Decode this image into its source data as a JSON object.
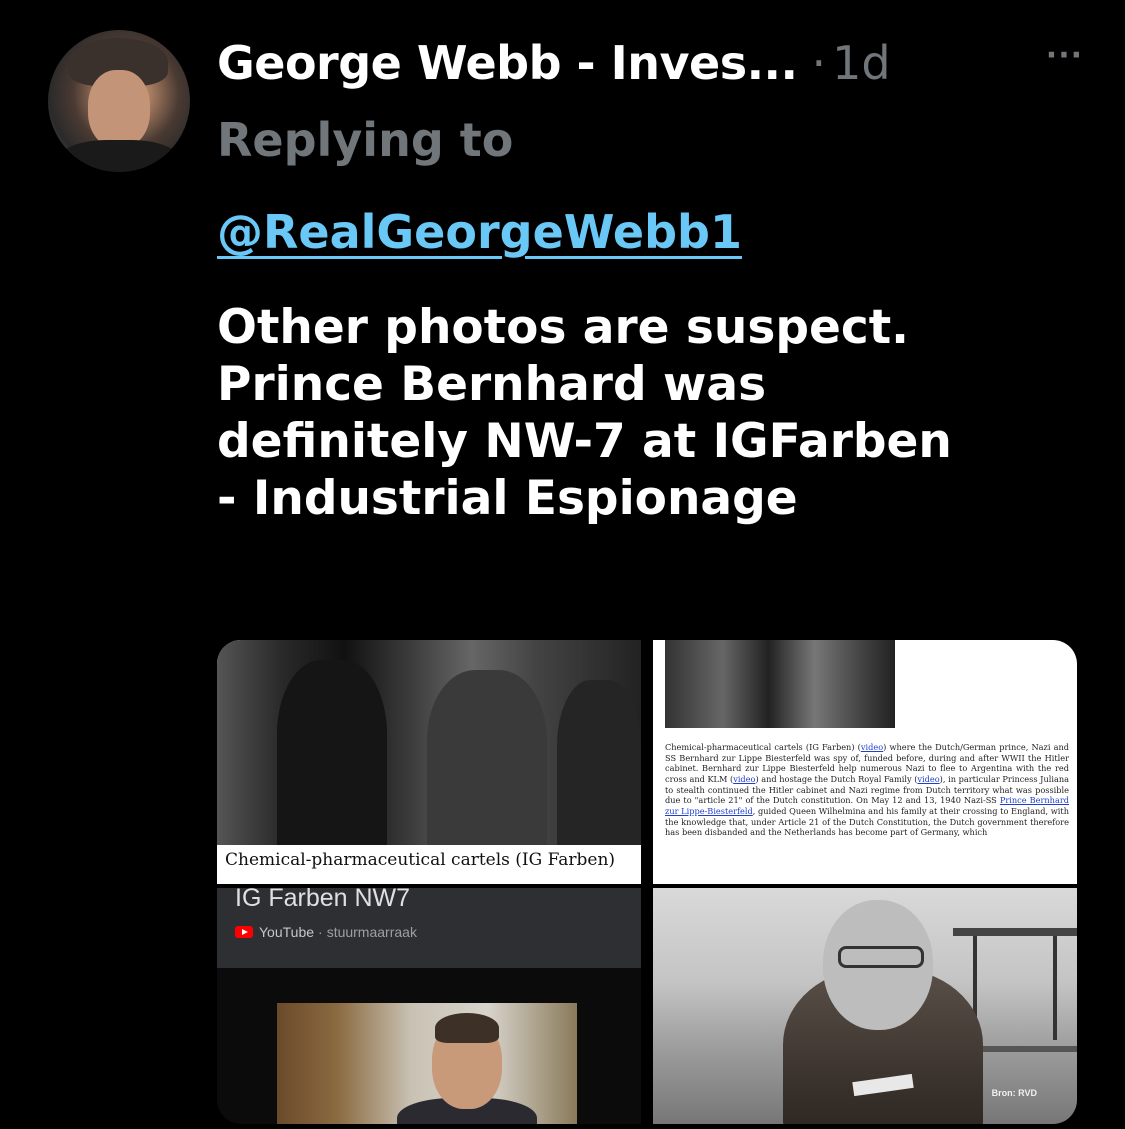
{
  "tweet": {
    "author_name": "George Webb - Inves...",
    "separator": "·",
    "timestamp": "1d",
    "more_glyph": "···",
    "replying_to_label": "Replying to",
    "reply_handle": "@RealGeorgeWebb1",
    "text_lines": [
      "Other photos are suspect.",
      "Prince Bernhard was",
      "definitely NW-7 at IGFarben",
      "- Industrial Espionage"
    ]
  },
  "media": {
    "image1": {
      "caption": "Chemical-pharmaceutical cartels (IG Farben)"
    },
    "image2": {
      "doc_before_link1": "Chemical-pharmaceutical cartels (IG Farben) (",
      "link1": "video",
      "doc_between1": ") where the Dutch/German prince, Nazi and SS Bernhard zur Lippe Biesterfeld was spy of, funded before, during and after WWII the Hitler cabinet. Bernhard zur Lippe Biesterfeld help numerous Nazi to flee to Argentina with the red cross and KLM (",
      "link2": "video",
      "doc_between2": ") and hostage the Dutch Royal Family (",
      "link3": "video",
      "doc_between3": "), in particular Princess Juliana to stealth continued the Hitler cabinet and Nazi regime from Dutch territory what was possible due to \"article 21\" of the Dutch constitution. On May 12 and 13, 1940 Nazi-SS ",
      "link4": "Prince Bernhard zur Lippe-Biesterfeld",
      "doc_after": ", guided Queen Wilhelmina and his family at their crossing to England, with the knowledge that, under Article 21 of the Dutch Constitution, the Dutch government therefore has been disbanded and the Netherlands has become part of Germany, which"
    },
    "image3": {
      "video_title": "IG Farben NW7",
      "source": "YouTube",
      "separator": "·",
      "channel": "stuurmaarraak"
    },
    "image4": {
      "credit": "Bron: RVD"
    }
  },
  "colors": {
    "background": "#000000",
    "primary_text": "#ffffff",
    "secondary_text": "#71767b",
    "link": "#6ac8f7",
    "youtube_red": "#ff0000"
  }
}
